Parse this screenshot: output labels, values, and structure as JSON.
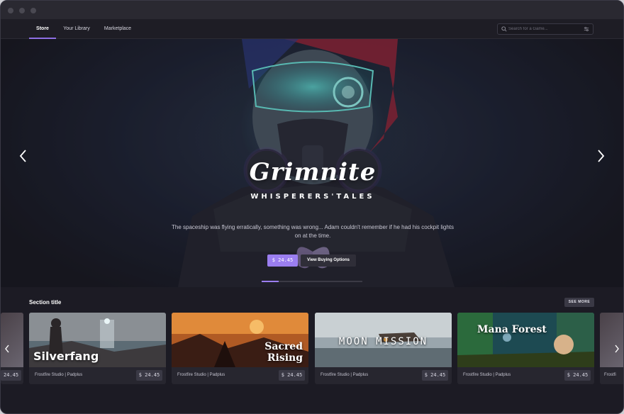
{
  "nav": {
    "tabs": [
      {
        "label": "Store",
        "active": true
      },
      {
        "label": "Your Library",
        "active": false
      },
      {
        "label": "Marketplace",
        "active": false
      }
    ],
    "search_placeholder": "Search for a Game..."
  },
  "hero": {
    "title": "Grimnite",
    "subtitle": "WHISPERERS'TALES",
    "description": "The spaceship was flying erratically, something was wrong... Adam couldn't remember if he had his cockpit lights on at the time.",
    "price_label": "$ 24.45",
    "options_label": "View Buying Options",
    "carousel_progress": 0.17
  },
  "section": {
    "title": "Section title",
    "see_more_label": "SEE MORE"
  },
  "partial_left": {
    "price": "24.45"
  },
  "partial_right": {
    "studio": "Frostfi"
  },
  "cards": [
    {
      "name": "Silverfang",
      "studio": "Frostfire Studio | Padplus",
      "price": "$ 24.45"
    },
    {
      "name": "Sacred Rising",
      "name_line1": "Sacred",
      "name_line2": "Rising",
      "studio": "Frostfire Studio | Padplus",
      "price": "$ 24.45"
    },
    {
      "name": "MOON MISSION",
      "studio": "Frostfire Studio | Padplus",
      "price": "$ 24.45"
    },
    {
      "name": "Mana Forest",
      "studio": "Frostfire Studio | Padplus",
      "price": "$ 24.45"
    }
  ],
  "colors": {
    "accent": "#9b7ef0",
    "background": "#1c1b24",
    "card": "#27262f"
  }
}
